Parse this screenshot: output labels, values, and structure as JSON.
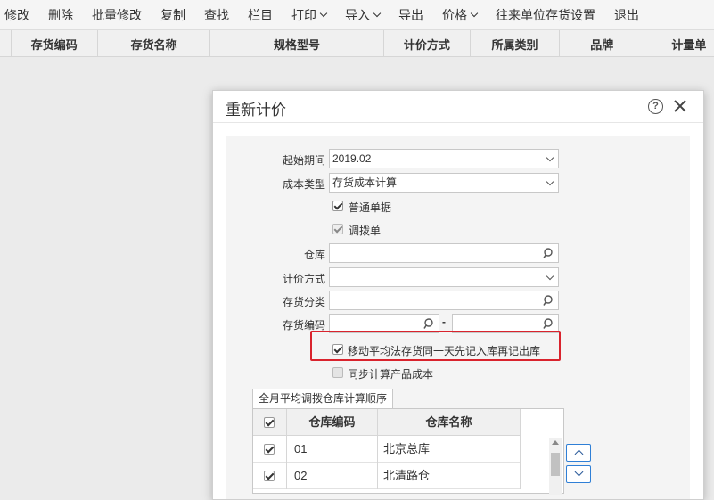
{
  "toolbar": {
    "items": [
      {
        "label": "修改"
      },
      {
        "label": "删除"
      },
      {
        "label": "批量修改"
      },
      {
        "label": "复制"
      },
      {
        "label": "查找"
      },
      {
        "label": "栏目"
      },
      {
        "label": "打印"
      },
      {
        "label": "导入"
      },
      {
        "label": "导出"
      },
      {
        "label": "价格"
      },
      {
        "label": "往来单位存货设置"
      },
      {
        "label": "退出"
      }
    ]
  },
  "grid": {
    "columns": [
      "存货编码",
      "存货名称",
      "规格型号",
      "计价方式",
      "所属类别",
      "品牌",
      "计量单"
    ]
  },
  "dialog": {
    "title": "重新计价",
    "help_glyph": "?",
    "fields": {
      "start_period_label": "起始期间",
      "start_period_value": "2019.02",
      "cost_type_label": "成本类型",
      "cost_type_value": "存货成本计算",
      "normal_docs_label": "普通单据",
      "transfer_docs_label": "调拨单",
      "warehouse_label": "仓库",
      "pricing_method_label": "计价方式",
      "inventory_category_label": "存货分类",
      "inventory_code_label": "存货编码",
      "range_dash": "-",
      "moving_avg_label": "移动平均法存货同一天先记入库再记出库",
      "sync_product_cost_label": "同步计算产品成本"
    },
    "checks": {
      "normal_docs": true,
      "transfer_docs": true,
      "moving_avg": true,
      "sync_product_cost": false
    },
    "tab_label": "全月平均调拨仓库计算顺序",
    "warehouse_table": {
      "headers": [
        "仓库编码",
        "仓库名称"
      ],
      "rows": [
        {
          "code": "01",
          "name": "北京总库",
          "checked": true
        },
        {
          "code": "02",
          "name": "北清路仓",
          "checked": true
        }
      ]
    }
  },
  "colors": {
    "highlight": "#d9232d",
    "button_border": "#2f7fd6"
  }
}
